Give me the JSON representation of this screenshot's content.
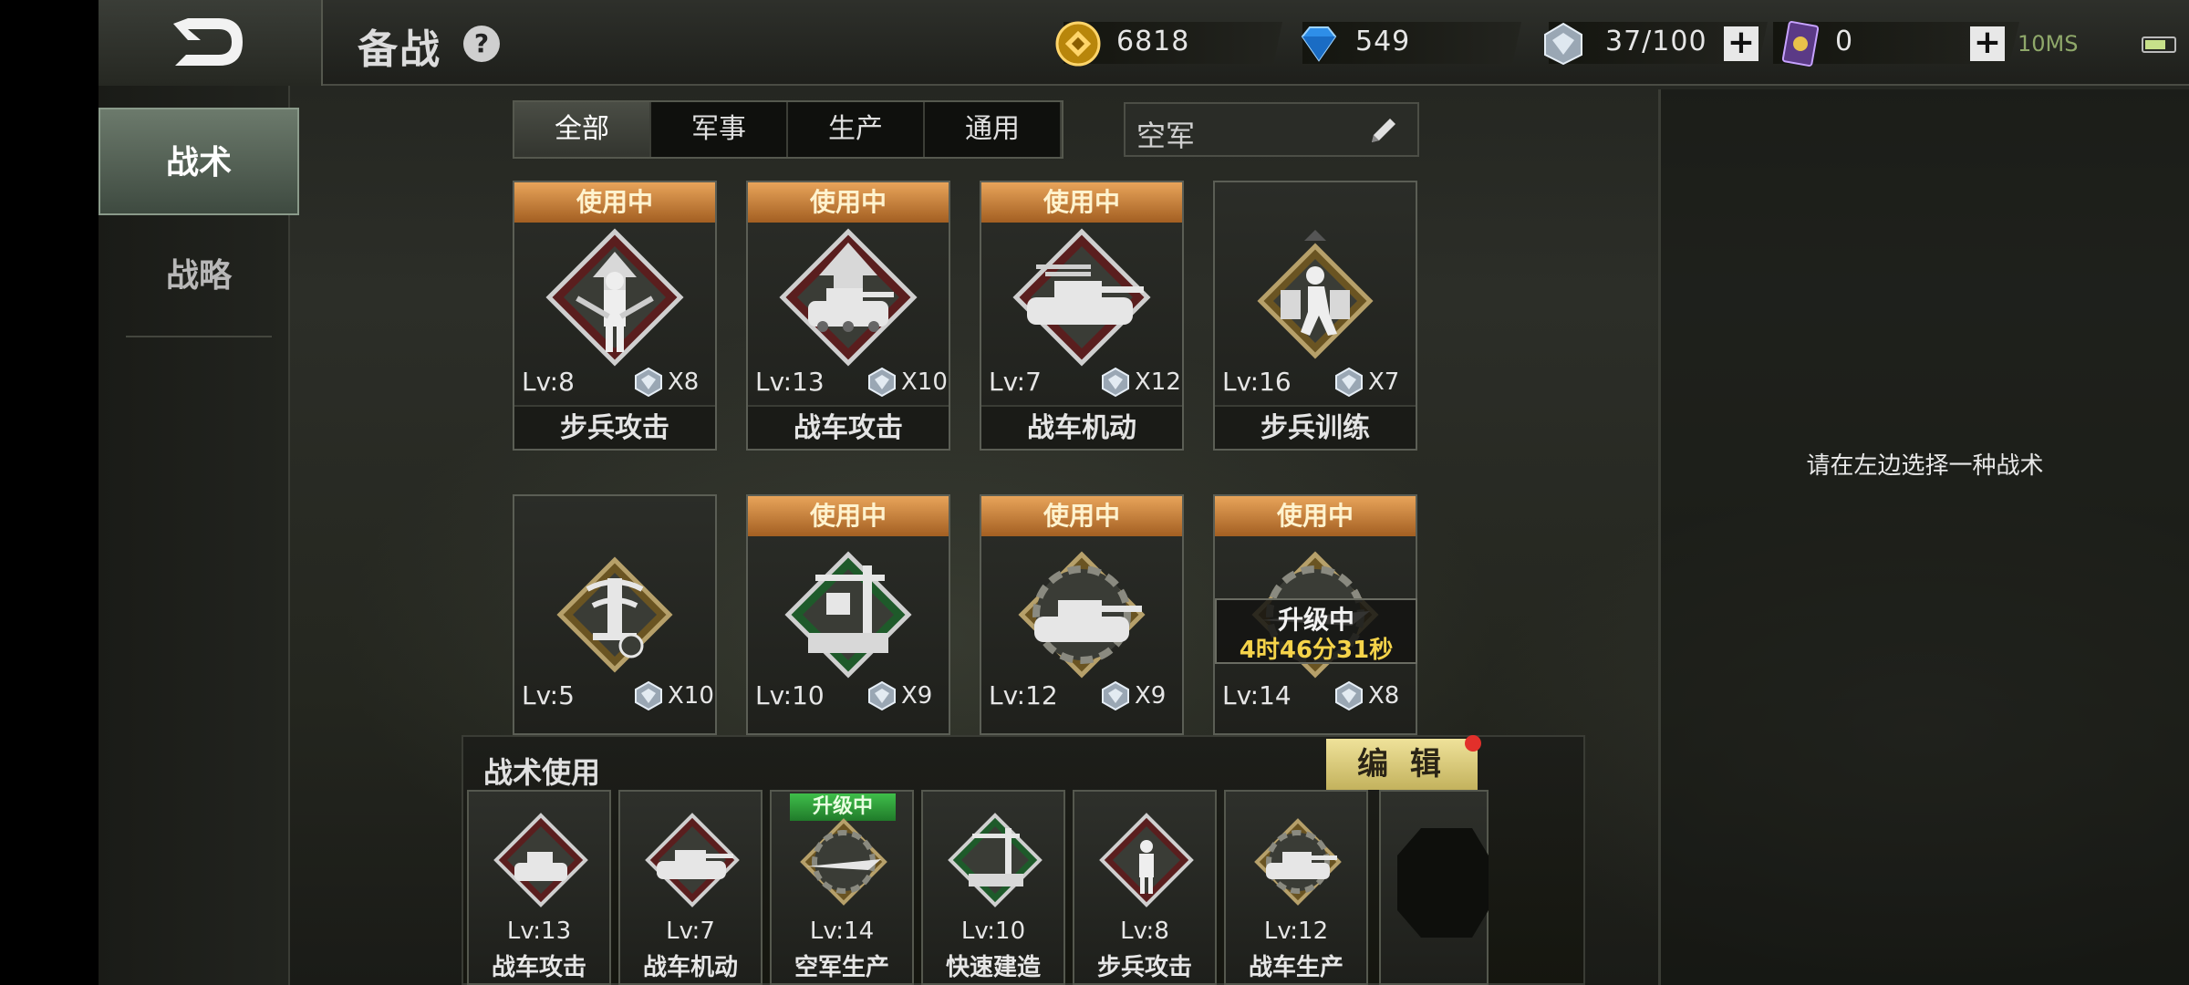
{
  "header": {
    "title": "备战",
    "help_label": "?",
    "resources": [
      {
        "name": "gold",
        "value": "6818",
        "icon": "gold-coin-icon"
      },
      {
        "name": "diamond",
        "value": "549",
        "icon": "diamond-icon"
      },
      {
        "name": "gem",
        "value": "37/100",
        "icon": "gem-icon"
      },
      {
        "name": "card",
        "value": "0",
        "icon": "card-icon"
      }
    ],
    "plus_label": "+",
    "ping": "10MS"
  },
  "sidenav": {
    "items": [
      {
        "label": "战术"
      },
      {
        "label": "战略"
      }
    ]
  },
  "filters": {
    "tabs": [
      {
        "label": "全部"
      },
      {
        "label": "军事"
      },
      {
        "label": "生产"
      },
      {
        "label": "通用"
      }
    ],
    "search_value": "空军"
  },
  "colors": {
    "badge_in_use": "#c8863e",
    "badge_upgrading": "#2f9e3a",
    "countdown": "#f5d34a",
    "edit_button": "#e0d27a"
  },
  "in_use_label": "使用中",
  "cards": [
    {
      "lv": "Lv:8",
      "count": "X8",
      "name": "步兵攻击",
      "in_use": true,
      "emblem": "infantry-attack-emblem"
    },
    {
      "lv": "Lv:13",
      "count": "X10",
      "name": "战车攻击",
      "in_use": true,
      "emblem": "vehicle-attack-emblem"
    },
    {
      "lv": "Lv:7",
      "count": "X12",
      "name": "战车机动",
      "in_use": true,
      "emblem": "vehicle-mobility-emblem"
    },
    {
      "lv": "Lv:16",
      "count": "X7",
      "name": "步兵训练",
      "in_use": false,
      "emblem": "infantry-training-emblem"
    },
    {
      "lv": "Lv:5",
      "count": "X10",
      "name": "",
      "in_use": false,
      "emblem": "antenna-timer-emblem"
    },
    {
      "lv": "Lv:10",
      "count": "X9",
      "name": "",
      "in_use": true,
      "emblem": "rapid-construction-emblem"
    },
    {
      "lv": "Lv:12",
      "count": "X9",
      "name": "",
      "in_use": true,
      "emblem": "vehicle-production-emblem"
    },
    {
      "lv": "Lv:14",
      "count": "X8",
      "name": "",
      "in_use": true,
      "emblem": "air-production-emblem"
    }
  ],
  "upgrade": {
    "title": "升级中",
    "time": "4时46分31秒"
  },
  "usage": {
    "title": "战术使用",
    "edit_label": "编 辑",
    "upgrading_label": "升级中",
    "slots": [
      {
        "lv": "Lv:13",
        "name": "战车攻击",
        "emblem": "vehicle-attack-emblem"
      },
      {
        "lv": "Lv:7",
        "name": "战车机动",
        "emblem": "vehicle-mobility-emblem"
      },
      {
        "lv": "Lv:14",
        "name": "空军生产",
        "emblem": "air-production-emblem",
        "upgrading": true
      },
      {
        "lv": "Lv:10",
        "name": "快速建造",
        "emblem": "rapid-construction-emblem"
      },
      {
        "lv": "Lv:8",
        "name": "步兵攻击",
        "emblem": "infantry-attack-emblem"
      },
      {
        "lv": "Lv:12",
        "name": "战车生产",
        "emblem": "vehicle-production-emblem"
      }
    ]
  },
  "detail": {
    "hint": "请在左边选择一种战术"
  }
}
